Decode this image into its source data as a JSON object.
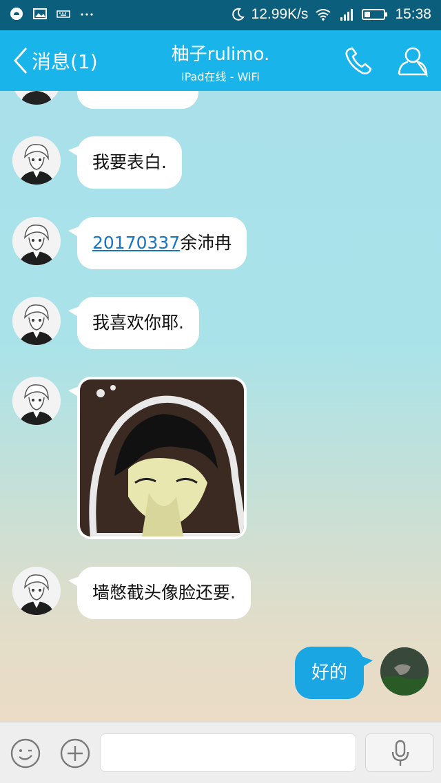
{
  "status_bar": {
    "net_speed": "12.99K/s",
    "time": "15:38",
    "icons": [
      "qq-icon",
      "image-icon",
      "keyboard-icon",
      "more-dots-icon",
      "moon-icon",
      "wifi-icon",
      "signal-icon",
      "battery-icon"
    ]
  },
  "header": {
    "back_label": "消息(1)",
    "title": "柚子rulimo.",
    "subtitle": "iPad在线 - WiFi",
    "accent": "#18b4ea"
  },
  "messages": [
    {
      "from": "friend",
      "text": "我要表白."
    },
    {
      "from": "friend",
      "link": "20170337",
      "text": "余沛冉"
    },
    {
      "from": "friend",
      "text": "我喜欢你耶."
    },
    {
      "from": "friend",
      "type": "image"
    },
    {
      "from": "friend",
      "text": "墙憋截头像脸还要."
    },
    {
      "from": "me",
      "text": "好的"
    }
  ],
  "input": {
    "value": "",
    "placeholder": ""
  },
  "colors": {
    "my_bubble": "#1aa6e2",
    "link": "#1a74c6"
  }
}
